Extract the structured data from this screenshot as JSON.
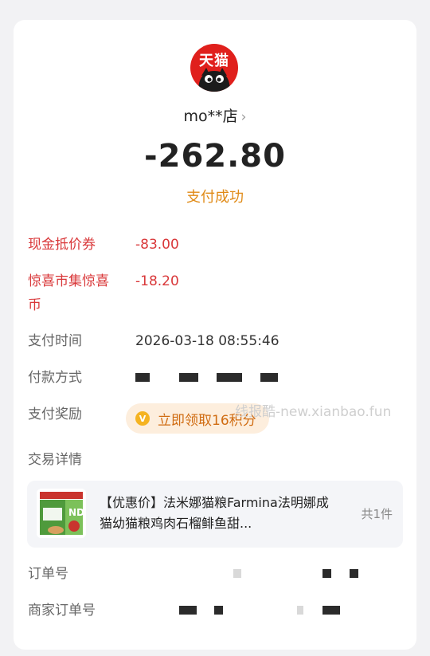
{
  "shop": {
    "logo_text": "天猫",
    "name": "mo**店",
    "chevron": "›"
  },
  "payment": {
    "amount": "-262.80",
    "status": "支付成功"
  },
  "discounts": [
    {
      "label": "现金抵价券",
      "value": "-83.00"
    },
    {
      "label": "惊喜市集惊喜币",
      "value": "-18.20"
    }
  ],
  "details": {
    "time_label": "支付时间",
    "time_value": "2026-03-18 08:55:46",
    "method_label": "付款方式",
    "reward_label": "支付奖励",
    "reward_text": "立即领取16积分",
    "trade_label": "交易详情",
    "order_label": "订单号",
    "merchant_order_label": "商家订单号"
  },
  "product": {
    "title": "【优惠价】法米娜猫粮Farmina法明娜成猫幼猫粮鸡肉石榴鲱鱼甜...",
    "count": "共1件",
    "thumb_text": "98%优质肉蛋白含量"
  },
  "watermark": "线报酷-new.xianbao.fun",
  "colors": {
    "accent_red": "#d9383a",
    "status_orange": "#e08a16",
    "tmall_red": "#e0201c"
  }
}
